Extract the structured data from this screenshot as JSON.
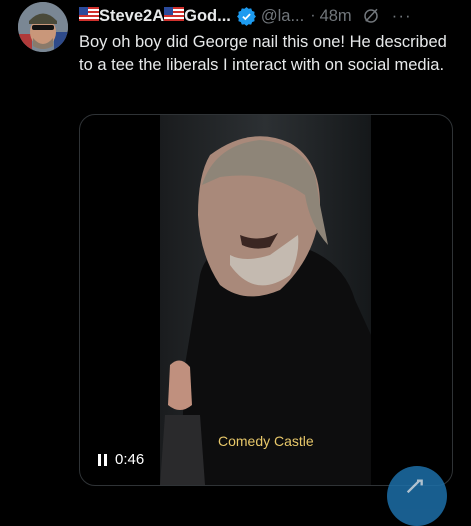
{
  "tweet": {
    "display_name_left": "Steve2A",
    "display_name_right": "God...",
    "handle": "@la...",
    "separator": "·",
    "time": "48m",
    "more_label": "···",
    "text": "Boy oh boy did George nail this one! He described to a tee the liberals I interact with on social media."
  },
  "media": {
    "caption": "Comedy Castle",
    "duration": "0:46",
    "state": "playing"
  },
  "colors": {
    "background": "#000000",
    "text": "#e7e9ea",
    "muted": "#71767b",
    "verified": "#1d9bf0",
    "caption": "#e8c86a",
    "fab": "#1d6fa8"
  },
  "icons": {
    "verified": "verified-badge-icon",
    "grok": "grok-icon",
    "more": "more-icon",
    "pause": "pause-icon",
    "compose": "compose-post-icon"
  }
}
